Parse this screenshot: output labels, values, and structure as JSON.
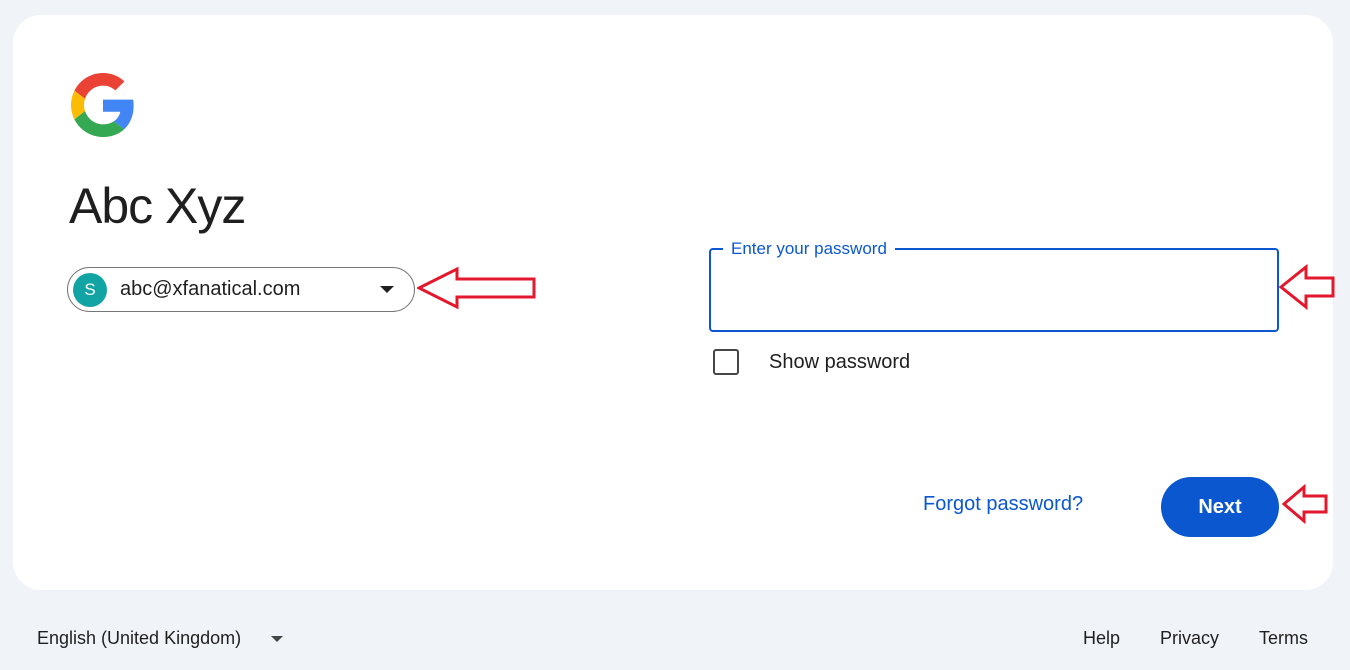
{
  "account": {
    "name": "Abc Xyz",
    "email": "abc@xfanatical.com",
    "avatar_initial": "S",
    "avatar_color": "#12a4a4"
  },
  "password": {
    "label": "Enter your password",
    "value": "",
    "show_password_label": "Show password",
    "show_password_checked": false
  },
  "actions": {
    "forgot_label": "Forgot password?",
    "next_label": "Next"
  },
  "footer": {
    "language": "English (United Kingdom)",
    "links": [
      "Help",
      "Privacy",
      "Terms"
    ]
  },
  "icons": {
    "logo": "google-g-logo",
    "account_dropdown": "chevron-down-icon",
    "language_dropdown": "chevron-down-icon",
    "annotation": "red-arrow-icon"
  },
  "colors": {
    "page_bg": "#f0f4f9",
    "card_bg": "#ffffff",
    "accent": "#0b57d0",
    "annotation": "#e3182d"
  }
}
